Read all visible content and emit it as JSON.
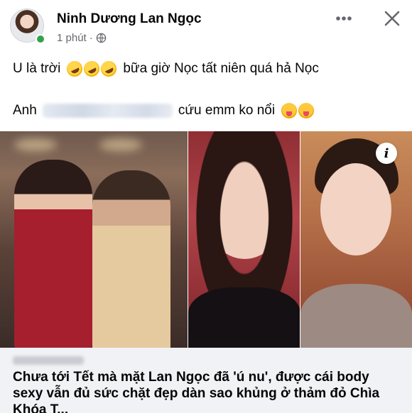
{
  "post": {
    "author": "Ninh Dương Lan Ngọc",
    "time": "1 phút",
    "separator": "·",
    "line1_before": "U là trời",
    "line1_after": "bữa giờ Nọc tất niên quá hả Nọc",
    "line2_before": "Anh",
    "line2_after": "cứu emm ko nổi",
    "line1_emojis": [
      "rolling-on-floor-laughing",
      "rolling-on-floor-laughing",
      "rolling-on-floor-laughing"
    ],
    "line2_emojis": [
      "squinting-face-with-tongue",
      "squinting-face-with-tongue"
    ]
  },
  "link_card": {
    "title": "Chưa tới Tết mà mặt Lan Ngọc đã 'ú nu', được cái body sexy vẫn đủ sức chặt đẹp dàn sao khủng ở thảm đỏ Chìa Khóa T..."
  },
  "image": {
    "info_glyph": "i"
  },
  "icons": {
    "more": "more-horizontal-icon",
    "close": "close-icon",
    "audience": "globe-icon",
    "info": "info-icon"
  },
  "colors": {
    "online_status": "#31a24c",
    "secondary_text": "#65676b",
    "card_bg": "#f0f2f5"
  }
}
